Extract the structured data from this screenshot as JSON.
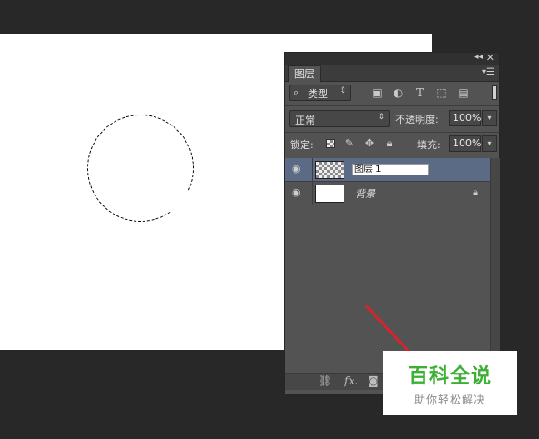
{
  "panel": {
    "tab_label": "图层",
    "collapse_icon": "double-chevron-left-icon",
    "close_icon": "close-icon",
    "menu_icon": "panel-menu-icon"
  },
  "filter": {
    "kind_label": "类型",
    "icons": [
      "image-filter-icon",
      "adjustment-filter-icon",
      "type-filter-icon",
      "shape-filter-icon",
      "smart-object-filter-icon"
    ]
  },
  "blend": {
    "mode": "正常",
    "opacity_label": "不透明度:",
    "opacity_value": "100%"
  },
  "lock": {
    "label": "锁定:",
    "fill_label": "填充:",
    "fill_value": "100%"
  },
  "layers": [
    {
      "name_input": "图层 1",
      "selected": true,
      "thumb": "transparent"
    },
    {
      "name": "背景",
      "selected": false,
      "thumb": "white",
      "locked": true
    }
  ],
  "bottom": {
    "link_icon": "link-icon",
    "fx_label": "fx.",
    "mask_icon": "mask-icon"
  },
  "watermark": {
    "title": "百科全说",
    "subtitle": "助你轻松解决"
  },
  "colors": {
    "panel_bg": "#535353",
    "selected_row": "#5b6a85",
    "annotation_red": "#d8232a",
    "watermark_green": "#3cb034"
  }
}
